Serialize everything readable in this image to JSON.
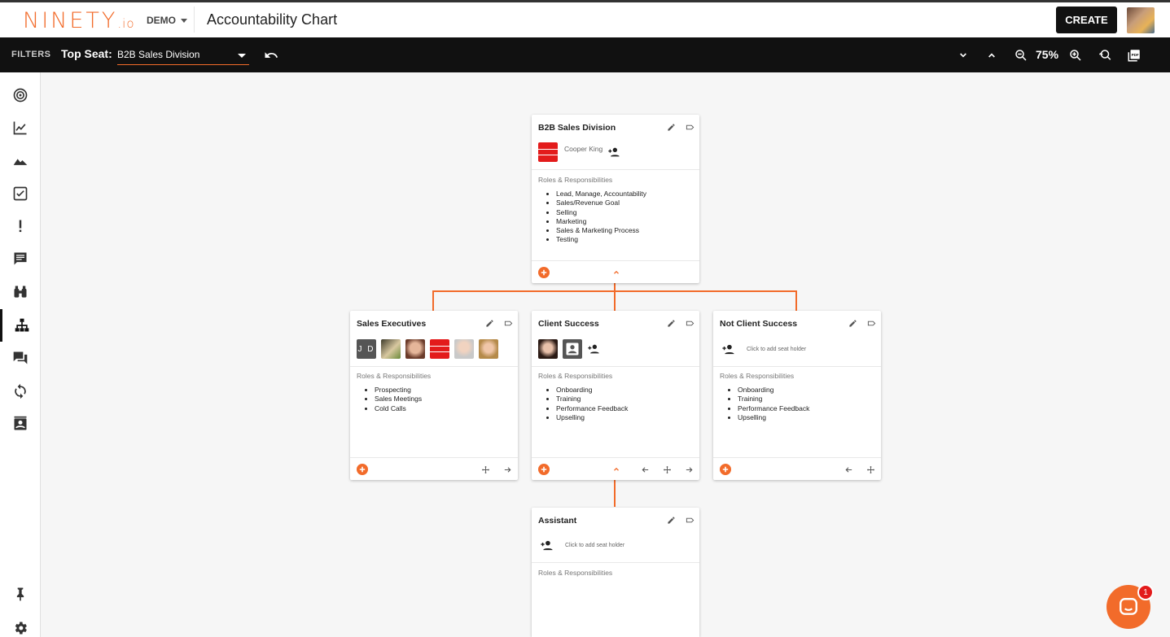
{
  "header": {
    "logo_text": "NINETY",
    "logo_suffix": ".io",
    "workspace": "DEMO",
    "page_title": "Accountability Chart",
    "create_label": "CREATE"
  },
  "filterbar": {
    "filters_label": "FILTERS",
    "top_seat_label": "Top Seat:",
    "top_seat_value": "B2B Sales Division",
    "zoom": "75%"
  },
  "sidebar": {
    "items": [
      "target-icon",
      "chart-line-icon",
      "terrain-icon",
      "checkbox-icon",
      "exclamation-icon",
      "comment-icon",
      "binoculars-icon",
      "org-chart-icon",
      "forum-icon",
      "sync-icon",
      "contact-icon"
    ],
    "bottom": [
      "pin-icon",
      "gear-icon"
    ]
  },
  "chart": {
    "top_card": {
      "title": "B2B Sales Division",
      "seat_holder": "Cooper King",
      "rr_label": "Roles & Responsibilities",
      "roles": [
        "Lead, Manage, Accountability",
        "Sales/Revenue Goal",
        "Selling",
        "Marketing",
        "Sales & Marketing Process",
        "Testing"
      ]
    },
    "sales_exec": {
      "title": "Sales Executives",
      "initials": "J D",
      "rr_label": "Roles & Responsibilities",
      "roles": [
        "Prospecting",
        "Sales Meetings",
        "Cold Calls"
      ]
    },
    "client_success": {
      "title": "Client Success",
      "rr_label": "Roles & Responsibilities",
      "roles": [
        "Onboarding",
        "Training",
        "Performance Feedback",
        "Upselling"
      ]
    },
    "not_client_success": {
      "title": "Not Client Success",
      "seat_hint": "Click to add seat holder",
      "rr_label": "Roles & Responsibilities",
      "roles": [
        "Onboarding",
        "Training",
        "Performance Feedback",
        "Upselling"
      ]
    },
    "assistant": {
      "title": "Assistant",
      "seat_hint": "Click to add seat holder",
      "rr_label": "Roles & Responsibilities"
    }
  },
  "chat": {
    "badge": "1"
  },
  "colors": {
    "accent": "#f26b2a",
    "dark": "#111111"
  }
}
